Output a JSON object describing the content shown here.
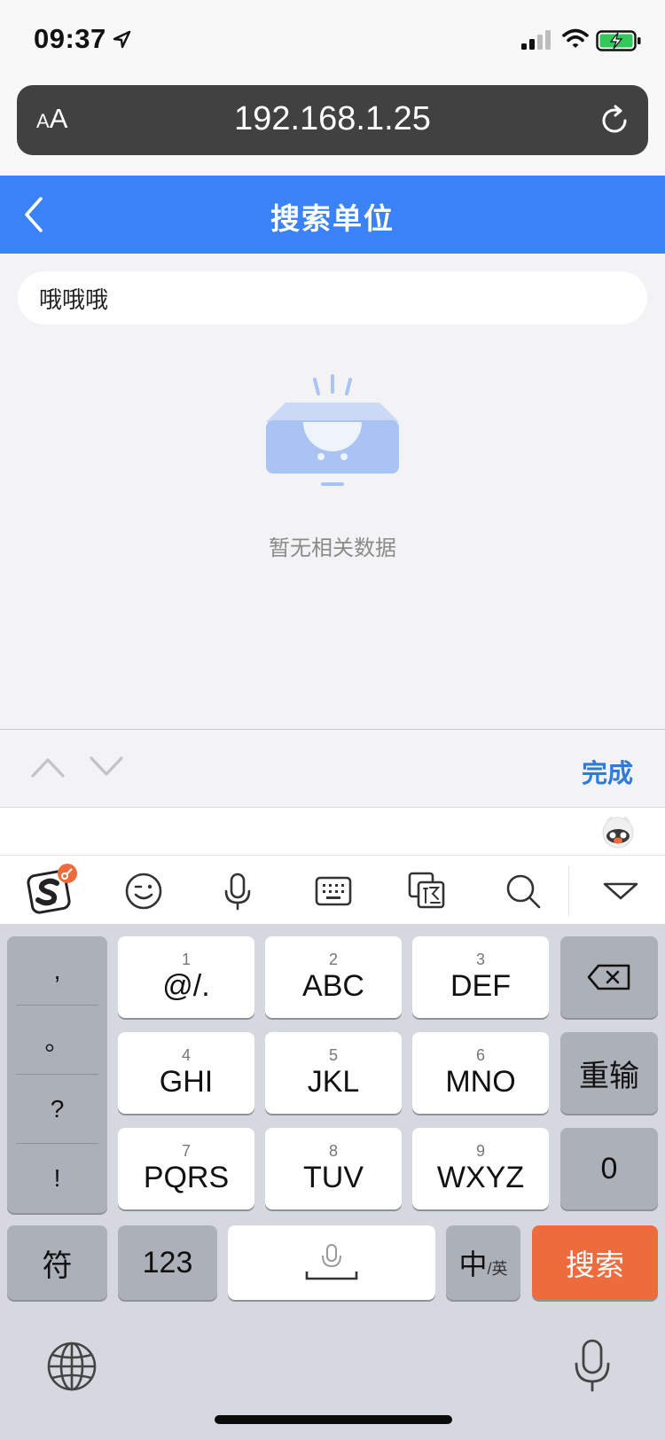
{
  "status_bar": {
    "time": "09:37"
  },
  "browser": {
    "aa_small": "A",
    "aa_big": "A",
    "url": "192.168.1.25"
  },
  "nav": {
    "title": "搜索单位"
  },
  "search": {
    "value": "哦哦哦",
    "placeholder": ""
  },
  "empty_state": {
    "text": "暂无相关数据"
  },
  "accessory": {
    "done_label": "完成"
  },
  "keyboard": {
    "punctuation": [
      ",",
      "。",
      "?",
      "!"
    ],
    "keys": [
      {
        "num": "1",
        "label": "@/."
      },
      {
        "num": "2",
        "label": "ABC"
      },
      {
        "num": "3",
        "label": "DEF"
      },
      {
        "num": "4",
        "label": "GHI"
      },
      {
        "num": "5",
        "label": "JKL"
      },
      {
        "num": "6",
        "label": "MNO"
      },
      {
        "num": "7",
        "label": "PQRS"
      },
      {
        "num": "8",
        "label": "TUV"
      },
      {
        "num": "9",
        "label": "WXYZ"
      }
    ],
    "reset_label": "重输",
    "zero_label": "0",
    "symbol_label": "符",
    "num123_label": "123",
    "lang_main": "中",
    "lang_sub": "/英",
    "search_label": "搜索"
  },
  "colors": {
    "nav_blue": "#3b82f6",
    "search_orange": "#ee6b3d",
    "done_blue": "#2f7bd9"
  }
}
